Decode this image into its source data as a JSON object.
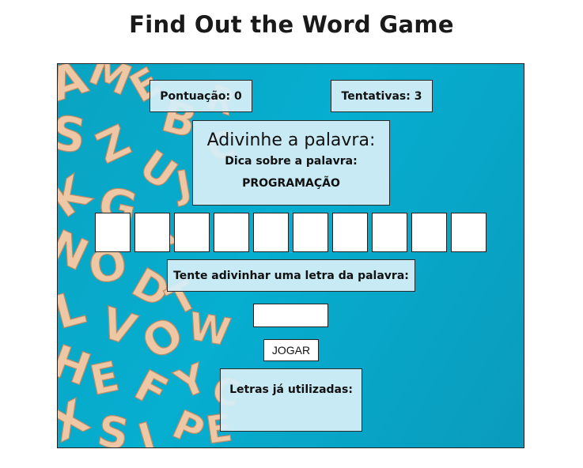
{
  "page": {
    "title": "Find Out the Word Game"
  },
  "status": {
    "score_label": "Pontuação: 0",
    "attempts_label": "Tentativas: 3"
  },
  "hint": {
    "heading": "Adivinhe a palavra:",
    "label": "Dica sobre a palavra:",
    "text": "PROGRAMAÇÃO"
  },
  "word": {
    "slots": [
      "",
      "",
      "",
      "",
      "",
      "",
      "",
      "",
      "",
      ""
    ]
  },
  "guess": {
    "prompt": "Tente adivinhar uma letra da palavra:",
    "input_value": "",
    "button_label": "JOGAR"
  },
  "used_letters": {
    "label": "Letras já utilizadas:",
    "letters": ""
  },
  "colors": {
    "board_background": "#06aed0",
    "panel_background": "#d4eef6",
    "tile_color": "#eec7a4"
  }
}
